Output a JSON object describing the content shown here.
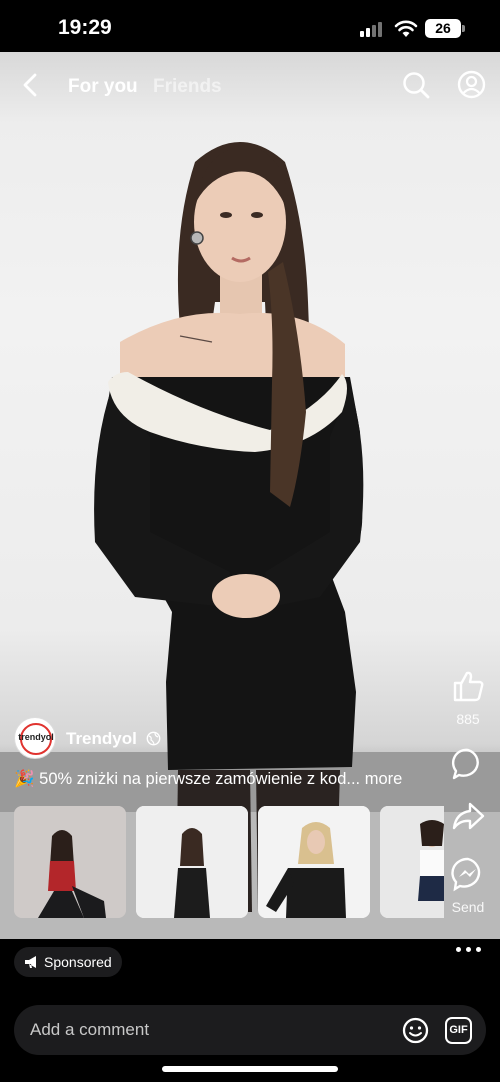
{
  "status_bar": {
    "time": "19:29",
    "battery": "26",
    "icons": [
      "signal-icon",
      "wifi-icon",
      "battery-icon"
    ]
  },
  "nav": {
    "tabs": [
      {
        "label": "For you",
        "active": true
      },
      {
        "label": "Friends",
        "active": false
      }
    ],
    "icons": [
      "back-icon",
      "search-icon",
      "profile-icon"
    ]
  },
  "post": {
    "advertiser_name": "Trendyol",
    "advertiser_logo_text": "trendyol",
    "caption_emoji": "🎉",
    "caption_text": "50% zniżki na pierwsze zamówienie z kod...",
    "caption_more": "more",
    "products": [
      "product-1",
      "product-2",
      "product-3",
      "product-4"
    ]
  },
  "rail": {
    "like_count": "885",
    "send_label": "Send",
    "icons": [
      "like-icon",
      "comment-icon",
      "share-icon",
      "messenger-icon"
    ]
  },
  "bottom": {
    "sponsored_label": "Sponsored",
    "comment_placeholder": "Add a comment",
    "gif_label": "GIF"
  },
  "colors": {
    "background": "#000000",
    "accent_logo": "#e0332f",
    "dress": "#141414",
    "collar": "#f1eee7"
  }
}
